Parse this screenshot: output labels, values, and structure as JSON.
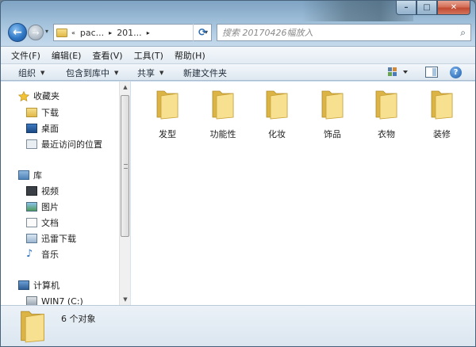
{
  "window": {
    "controls": {
      "minimize": "–",
      "maximize": "□",
      "close": "✕"
    }
  },
  "nav": {
    "back_glyph": "←",
    "forward_glyph": "→",
    "address_segments": [
      "«",
      "pac...",
      "201...",
      "▸"
    ],
    "search_placeholder": "搜索 20170426幅放入"
  },
  "menu": [
    "文件(F)",
    "编辑(E)",
    "查看(V)",
    "工具(T)",
    "帮助(H)"
  ],
  "toolbar": {
    "organize": "组织",
    "include_in_library": "包含到库中",
    "share": "共享",
    "new_folder": "新建文件夹",
    "help": "?"
  },
  "sidebar": {
    "favorites": {
      "header": "收藏夹",
      "items": [
        "下载",
        "桌面",
        "最近访问的位置"
      ]
    },
    "libraries": {
      "header": "库",
      "items": [
        "视频",
        "图片",
        "文档",
        "迅雷下载",
        "音乐"
      ]
    },
    "computer": {
      "header": "计算机",
      "items": [
        "WIN7 (C:)"
      ]
    }
  },
  "folders": [
    "发型",
    "功能性",
    "化妆",
    "饰品",
    "衣物",
    "装修"
  ],
  "status": {
    "count": "6 个对象"
  },
  "colors": {
    "folder_light": "#f7e08f",
    "folder_dark": "#dcb445",
    "accent": "#2f78c6"
  }
}
